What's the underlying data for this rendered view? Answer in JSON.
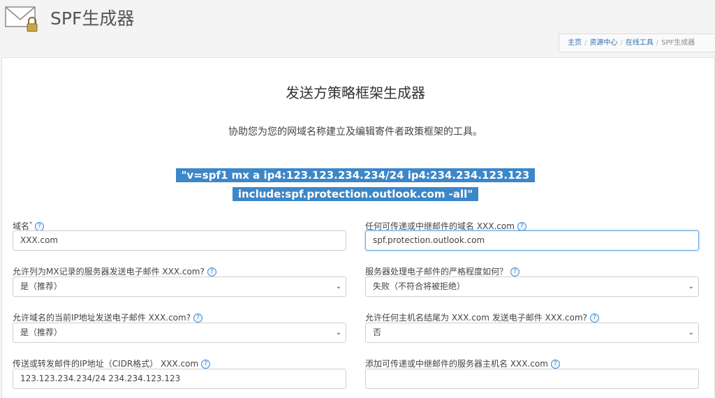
{
  "header": {
    "title": "SPF生成器"
  },
  "breadcrumb": {
    "items": [
      "主页",
      "资源中心",
      "在线工具"
    ],
    "current": "SPF生成器"
  },
  "form": {
    "title": "发送方策略框架生成器",
    "subtitle": "协助您为您的网域名称建立及编辑寄件者政策框架的工具。",
    "spf_line1": "\"v=spf1 mx a ip4:123.123.234.234/24 ip4:234.234.123.123",
    "spf_line2": "include:spf.protection.outlook.com -all\""
  },
  "fields": {
    "domain": {
      "label": "域名",
      "required": "*",
      "value": "XXX.com"
    },
    "relay_domain": {
      "label": "任何可传递或中继邮件的域名 XXX.com",
      "value": "spf.protection.outlook.com"
    },
    "mx": {
      "label": "允许列为MX记录的服务器发送电子邮件 XXX.com?",
      "value": "是（推荐）"
    },
    "strictness": {
      "label": "服务器处理电子邮件的严格程度如何？",
      "value": "失败（不符合将被拒绝）"
    },
    "ip": {
      "label": "允许域名的当前IP地址发送电子邮件 XXX.com?",
      "value": "是（推荐）"
    },
    "ptr": {
      "label": "允许任何主机名结尾为 XXX.com 发送电子邮件 XXX.com?",
      "value": "否"
    },
    "cidr": {
      "label": "传送或转发邮件的IP地址（CIDR格式） XXX.com",
      "value": "123.123.234.234/24 234.234.123.123"
    },
    "hostnames": {
      "label": "添加可传递或中继邮件的服务器主机名 XXX.com",
      "value": ""
    }
  },
  "icons": {
    "help": "?",
    "chevron": "⌄"
  },
  "colors": {
    "accent": "#3c87c8",
    "link": "#2a6fb5"
  }
}
